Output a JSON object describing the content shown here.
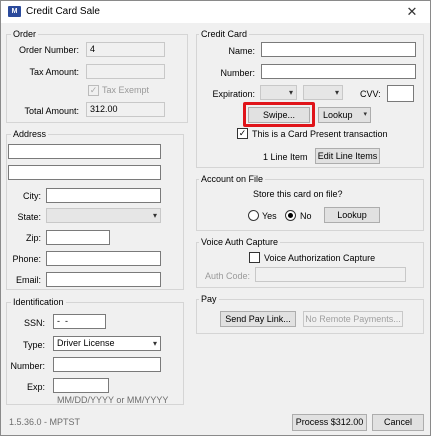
{
  "window": {
    "title": "Credit Card Sale",
    "close_glyph": "✕"
  },
  "order": {
    "group_title": "Order",
    "order_number_label": "Order Number:",
    "order_number_value": "4",
    "tax_amount_label": "Tax Amount:",
    "tax_amount_value": "",
    "tax_exempt_label": "Tax Exempt",
    "tax_exempt_checked": true,
    "total_amount_label": "Total Amount:",
    "total_amount_value": "312.00"
  },
  "address": {
    "group_title": "Address",
    "line1_value": "",
    "line2_value": "",
    "city_label": "City:",
    "state_label": "State:",
    "zip_label": "Zip:",
    "phone_label": "Phone:",
    "email_label": "Email:"
  },
  "identification": {
    "group_title": "Identification",
    "ssn_label": "SSN:",
    "ssn_value": "-  -",
    "type_label": "Type:",
    "type_value": "Driver License",
    "number_label": "Number:",
    "exp_label": "Exp:",
    "exp_hint": "MM/DD/YYYY or MM/YYYY"
  },
  "credit_card": {
    "group_title": "Credit Card",
    "name_label": "Name:",
    "number_label": "Number:",
    "expiration_label": "Expiration:",
    "cvv_label": "CVV:",
    "swipe_button": "Swipe...",
    "lookup_button": "Lookup",
    "card_present_label": "This is a Card Present transaction",
    "card_present_checked": true,
    "line_item_text": "1 Line Item",
    "edit_line_items_button": "Edit Line Items"
  },
  "account_on_file": {
    "group_title": "Account on File",
    "question": "Store this card on file?",
    "yes_label": "Yes",
    "no_label": "No",
    "selected": "No",
    "lookup_button": "Lookup"
  },
  "voice_auth": {
    "group_title": "Voice Auth Capture",
    "checkbox_label": "Voice Authorization Capture",
    "auth_code_label": "Auth Code:"
  },
  "pay": {
    "group_title": "Pay",
    "send_pay_link_button": "Send Pay Link...",
    "no_remote_payments_button": "No Remote Payments..."
  },
  "footer": {
    "version": "1.5.36.0 - MPTST",
    "process_button": "Process $312.00",
    "cancel_button": "Cancel"
  }
}
